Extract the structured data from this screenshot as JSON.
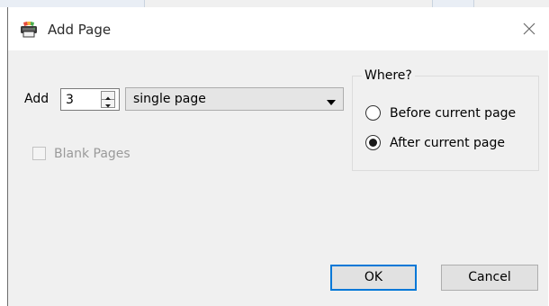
{
  "dialog": {
    "title": "Add Page",
    "icon": "printer-app-icon",
    "close_icon": "close-icon"
  },
  "form": {
    "add_label": "Add",
    "count_value": "3",
    "page_type_value": "single page",
    "blank_pages_label": "Blank Pages",
    "blank_pages_checked": false,
    "blank_pages_enabled": false
  },
  "where": {
    "title": "Where?",
    "options": [
      {
        "label": "Before current page",
        "selected": false
      },
      {
        "label": "After current page",
        "selected": true
      }
    ]
  },
  "buttons": {
    "ok_label": "OK",
    "cancel_label": "Cancel"
  },
  "colors": {
    "focus_border": "#0078d7",
    "window_bg": "#f0f0f0"
  }
}
